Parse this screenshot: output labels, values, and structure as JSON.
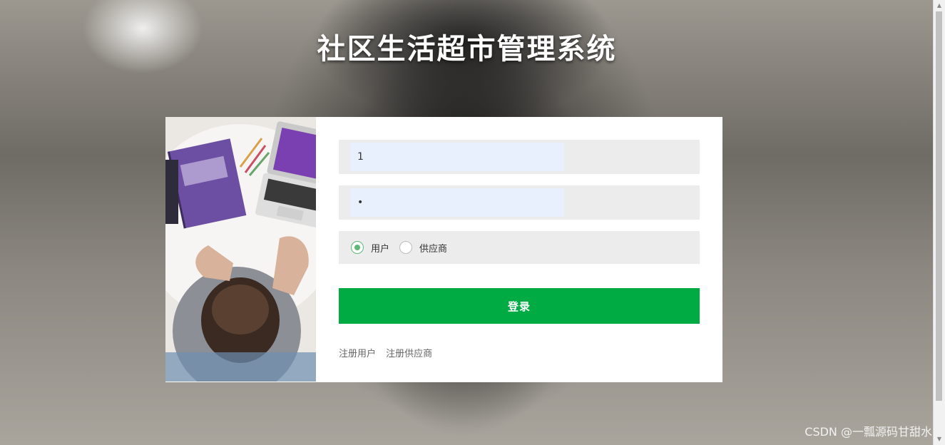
{
  "page": {
    "title": "社区生活超市管理系统"
  },
  "login": {
    "username_value": "1",
    "password_value": "•",
    "roles": [
      {
        "label": "用户",
        "checked": true
      },
      {
        "label": "供应商",
        "checked": false
      }
    ],
    "submit_label": "登录",
    "links": {
      "register_user": "注册用户",
      "register_supplier": "注册供应商"
    }
  },
  "watermark": "CSDN @一瓢源码甘甜水",
  "colors": {
    "accent_green": "#00ab43",
    "radio_green": "#5fb878",
    "field_bg": "#ececec",
    "input_bg": "#e8f0fe"
  }
}
